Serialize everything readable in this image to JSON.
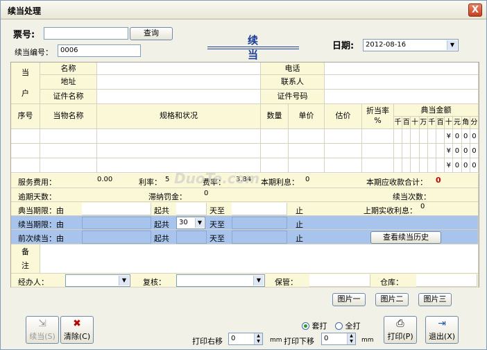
{
  "window": {
    "title": "续当处理",
    "close_label": "X"
  },
  "header": {
    "ticket_label": "票号:",
    "ticket_value": "",
    "query_btn": "查询",
    "renew_no_label": "续当编号：",
    "renew_no_value": "0006",
    "center_title": "续 当",
    "date_label": "日期:",
    "date_value": "2012-08-16"
  },
  "customer": {
    "side_label_1": "当",
    "side_label_2": "户",
    "name": "名称",
    "address": "地址",
    "id_name": "证件名称",
    "phone": "电话",
    "contact": "联系人",
    "id_no": "证件号码"
  },
  "item_table": {
    "headers": {
      "seq": "序号",
      "item_name": "当物名称",
      "spec": "规格和状况",
      "qty": "数量",
      "price": "单价",
      "estimate": "估价",
      "discount": "折当率",
      "discount_unit": "%",
      "amount": "典当金额"
    },
    "amount_digits": [
      "千",
      "百",
      "十",
      "万",
      "千",
      "百",
      "十",
      "元",
      "角",
      "分"
    ],
    "rows": [
      {
        "yen": "¥",
        "d1": "0",
        "d2": "0",
        "d3": "0"
      },
      {
        "yen": "¥",
        "d1": "0",
        "d2": "0",
        "d3": "0"
      },
      {
        "yen": "¥",
        "d1": "0",
        "d2": "0",
        "d3": "0"
      }
    ]
  },
  "fees": {
    "service_fee_label": "服务费用：",
    "service_fee_value": "0.00",
    "rate_label": "利率：",
    "rate_value": "5",
    "fee_rate_label": "费率：",
    "fee_rate_value": "3.84",
    "interest_label": "本期利息：",
    "interest_value": "0",
    "total_label": "本期应收款合计：",
    "total_value": "0",
    "overdue_label": "逾期天数：",
    "late_fee_label": "滞纳罚金：",
    "late_fee_value": "0",
    "renew_count_label": "续当次数：",
    "last_interest_label": "上期实收利息：",
    "last_interest_value": "0"
  },
  "periods": {
    "pawn_label": "典当期限：由",
    "renew_label": "续当期限：由",
    "prev_label": "前次续当：由",
    "start_word": "起共",
    "days_word": "天至",
    "end_word": "止",
    "renew_days_value": "30",
    "history_btn": "查看续当历史"
  },
  "remark": {
    "label_1": "备",
    "label_2": "注"
  },
  "staff": {
    "handler_label": "经办人：",
    "reviewer_label": "复核：",
    "keeper_label": "保管：",
    "warehouse_label": "仓库："
  },
  "pictures": {
    "pic1": "图片一",
    "pic2": "图片二",
    "pic3": "图片三"
  },
  "footer": {
    "renew_btn": "续当(S)",
    "clear_btn": "清除(C)",
    "print_right_label": "打印右移",
    "print_right_value": "0",
    "mm1": "mm",
    "print_down_label": "打印下移",
    "print_down_value": "0",
    "mm2": "mm",
    "opt_overlay": "套打",
    "opt_full": "全打",
    "print_btn": "打印(P)",
    "exit_btn": "退出(X)"
  },
  "watermark": "DuoTe.com"
}
